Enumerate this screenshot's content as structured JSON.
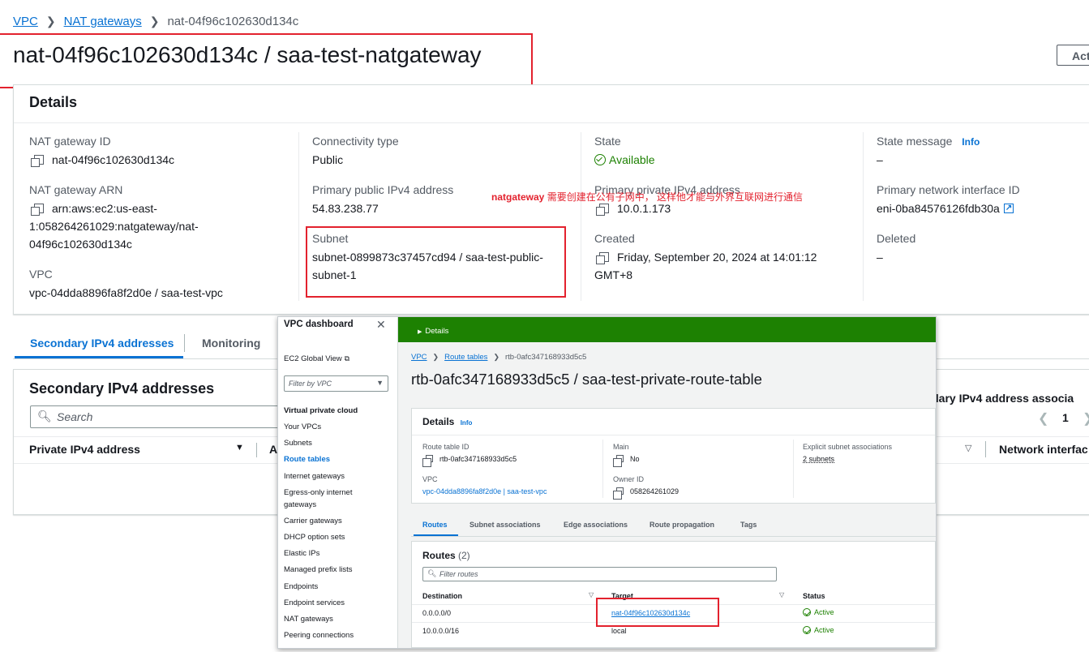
{
  "breadcrumb": {
    "vpc": "VPC",
    "nat": "NAT gateways",
    "current": "nat-04f96c102630d134c"
  },
  "page_title": "nat-04f96c102630d134c / saa-test-natgateway",
  "actions_button": "Act",
  "details": {
    "title": "Details",
    "nat_gateway_id_label": "NAT gateway ID",
    "nat_gateway_id": "nat-04f96c102630d134c",
    "nat_gateway_arn_label": "NAT gateway ARN",
    "arn_line1": "arn:aws:ec2:us-east-",
    "arn_line2": "1:058264261029:natgateway/nat-",
    "arn_line3": "04f96c102630d134c",
    "vpc_label": "VPC",
    "vpc_value": "vpc-04dda8896fa8f2d0e / saa-test-vpc",
    "connectivity_label": "Connectivity type",
    "connectivity_value": "Public",
    "public_ip_label": "Primary public IPv4 address",
    "public_ip": "54.83.238.77",
    "subnet_label": "Subnet",
    "subnet_line1": "subnet-0899873c37457cd94 / saa-test-public-",
    "subnet_line2": "subnet-1",
    "state_label": "State",
    "state_value": "Available",
    "private_ip_label": "Primary private IPv4 address",
    "private_ip": "10.0.1.173",
    "created_label": "Created",
    "created_line1": "Friday, September 20, 2024 at 14:01:12",
    "created_line2": "GMT+8",
    "state_message_label": "State message",
    "info": "Info",
    "state_message_value": "–",
    "eni_label": "Primary network interface ID",
    "eni_value": "eni-0ba84576126fdb30a",
    "deleted_label": "Deleted",
    "deleted_value": "–"
  },
  "annotation": {
    "bold": "natgateway",
    "text": " 需要创建在公有子网中， 这样他才能与外界互联网进行通信"
  },
  "tabs": {
    "secondary": "Secondary IPv4 addresses",
    "monitoring": "Monitoring"
  },
  "secondary_panel": {
    "title": "Secondary IPv4 addresses",
    "search_placeholder": "Search",
    "col_private": "Private IPv4 address",
    "col_a": "A",
    "right_title": "ondary IPv4 address associa",
    "page": "1",
    "col_network": "Network interfac"
  },
  "overlay": {
    "sidebar": {
      "title": "VPC dashboard",
      "ec2_global": "EC2 Global View",
      "filter_placeholder": "Filter by VPC",
      "section": "Virtual private cloud",
      "items": [
        "Your VPCs",
        "Subnets",
        "Route tables",
        "Internet gateways",
        "Egress-only internet",
        "gateways",
        "Carrier gateways",
        "DHCP option sets",
        "Elastic IPs",
        "Managed prefix lists",
        "Endpoints",
        "Endpoint services",
        "NAT gateways",
        "Peering connections"
      ]
    },
    "banner": {
      "details": "Details"
    },
    "breadcrumb": {
      "vpc": "VPC",
      "route_tables": "Route tables",
      "current": "rtb-0afc347168933d5c5"
    },
    "title": "rtb-0afc347168933d5c5 / saa-test-private-route-table",
    "details": {
      "title": "Details",
      "info": "Info",
      "rt_id_label": "Route table ID",
      "rt_id": "rtb-0afc347168933d5c5",
      "main_label": "Main",
      "main_value": "No",
      "explicit_label": "Explicit subnet associations",
      "explicit_value": "2 subnets",
      "vpc_label": "VPC",
      "vpc_value": "vpc-04dda8896fa8f2d0e | saa-test-vpc",
      "owner_label": "Owner ID",
      "owner_value": "058264261029"
    },
    "tabs": [
      "Routes",
      "Subnet associations",
      "Edge associations",
      "Route propagation",
      "Tags"
    ],
    "routes": {
      "title": "Routes",
      "count": "(2)",
      "filter_placeholder": "Filter routes",
      "headers": [
        "Destination",
        "Target",
        "Status"
      ],
      "rows": [
        {
          "destination": "0.0.0.0/0",
          "target": "nat-04f96c102630d134c",
          "status": "Active"
        },
        {
          "destination": "10.0.0.0/16",
          "target": "local",
          "status": "Active"
        }
      ]
    }
  }
}
